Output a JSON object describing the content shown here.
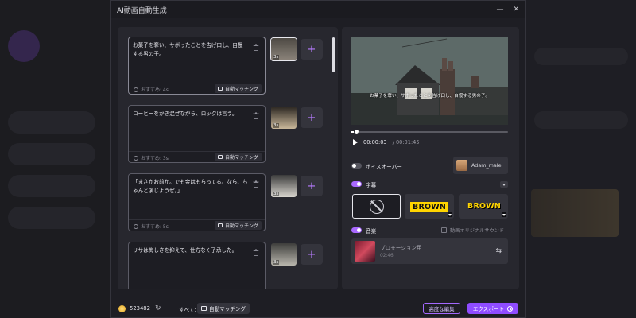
{
  "window": {
    "title": "AI動画自動生成",
    "minimize_icon": "minimize-icon",
    "close_icon": "close-icon"
  },
  "scenes": [
    {
      "text": "お菓子を奪い、サボったことを告げ口し、自慢する男の子。",
      "recommend": "おすすめ: 4s",
      "auto_label": "自動マッチング",
      "thumb_duration": "3s",
      "thumb_colors": [
        "#4e4a44",
        "#8b837a"
      ]
    },
    {
      "text": "コーヒーをかき混ぜながら、ロックは言う。",
      "recommend": "おすすめ: 3s",
      "auto_label": "自動マッチング",
      "thumb_duration": "3s",
      "thumb_colors": [
        "#2a2520",
        "#c9b79a"
      ]
    },
    {
      "text": "「まさかお前か。でも金はもらってる。なら、ちゃんと演じようぜ。」",
      "recommend": "おすすめ: 5s",
      "auto_label": "自動マッチング",
      "thumb_duration": "3s",
      "thumb_colors": [
        "#3a3a3a",
        "#d9d6cf"
      ]
    },
    {
      "text": "リサは悔しさを抑えて、仕方なく了承した。",
      "recommend": "",
      "auto_label": "",
      "thumb_duration": "3s",
      "thumb_colors": [
        "#3e3e3c",
        "#b9b6ad"
      ]
    }
  ],
  "preview": {
    "subtitle": "お菓子を奪い、サボったことを告げ口し、自慢する男の子。",
    "current_time": "00:00:03",
    "total_time": "/ 00:01:45",
    "progress": 0.03
  },
  "voiceover": {
    "label": "ボイスオーバー",
    "enabled": false,
    "voice_name": "Adam_male"
  },
  "subtitles": {
    "label": "字幕",
    "enabled": true,
    "styles": [
      "none",
      "BROWN",
      "BROWN"
    ]
  },
  "music": {
    "label": "音楽",
    "enabled": true,
    "original_sound_label": "動画オリジナルサウンド",
    "original_sound_checked": false,
    "track_title": "プロモーション用",
    "track_duration": "02:46"
  },
  "footer": {
    "credits": "523482",
    "all_label": "すべて:",
    "all_auto_label": "自動マッチング",
    "advanced_edit_label": "高度な編集",
    "export_label": "エクスポート"
  },
  "colors": {
    "accent": "#8f4cff",
    "toggle_on": "#a969ff",
    "plus": "#b77cff"
  }
}
